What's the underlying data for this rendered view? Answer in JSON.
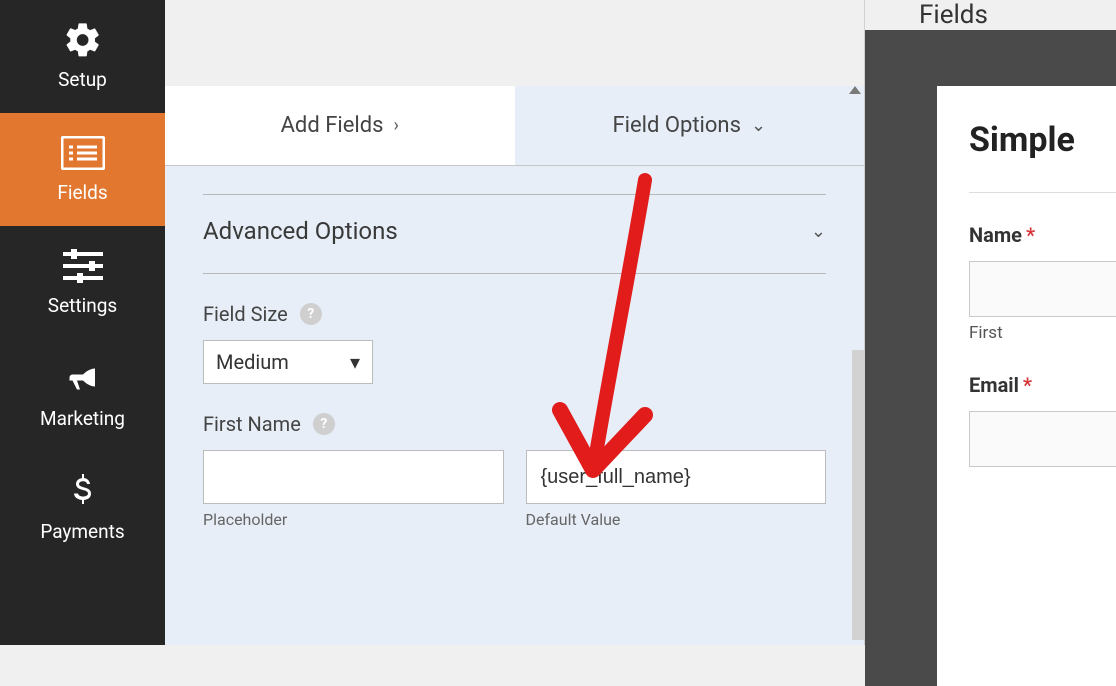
{
  "sidebar": {
    "items": [
      {
        "label": "Setup",
        "icon": "gear"
      },
      {
        "label": "Fields",
        "icon": "list"
      },
      {
        "label": "Settings",
        "icon": "sliders"
      },
      {
        "label": "Marketing",
        "icon": "megaphone"
      },
      {
        "label": "Payments",
        "icon": "dollar"
      }
    ],
    "active_index": 1
  },
  "tabs": {
    "add_fields": "Add Fields",
    "field_options": "Field Options"
  },
  "options": {
    "section_title": "Advanced Options",
    "field_size_label": "Field Size",
    "field_size_value": "Medium",
    "first_name_label": "First Name",
    "placeholder_sublabel": "Placeholder",
    "placeholder_value": "",
    "default_value_sublabel": "Default Value",
    "default_value_value": "{user_full_name}"
  },
  "right": {
    "header": "Fields",
    "form_title": "Simple",
    "name_label": "Name",
    "name_sublabel": "First",
    "email_label": "Email"
  }
}
